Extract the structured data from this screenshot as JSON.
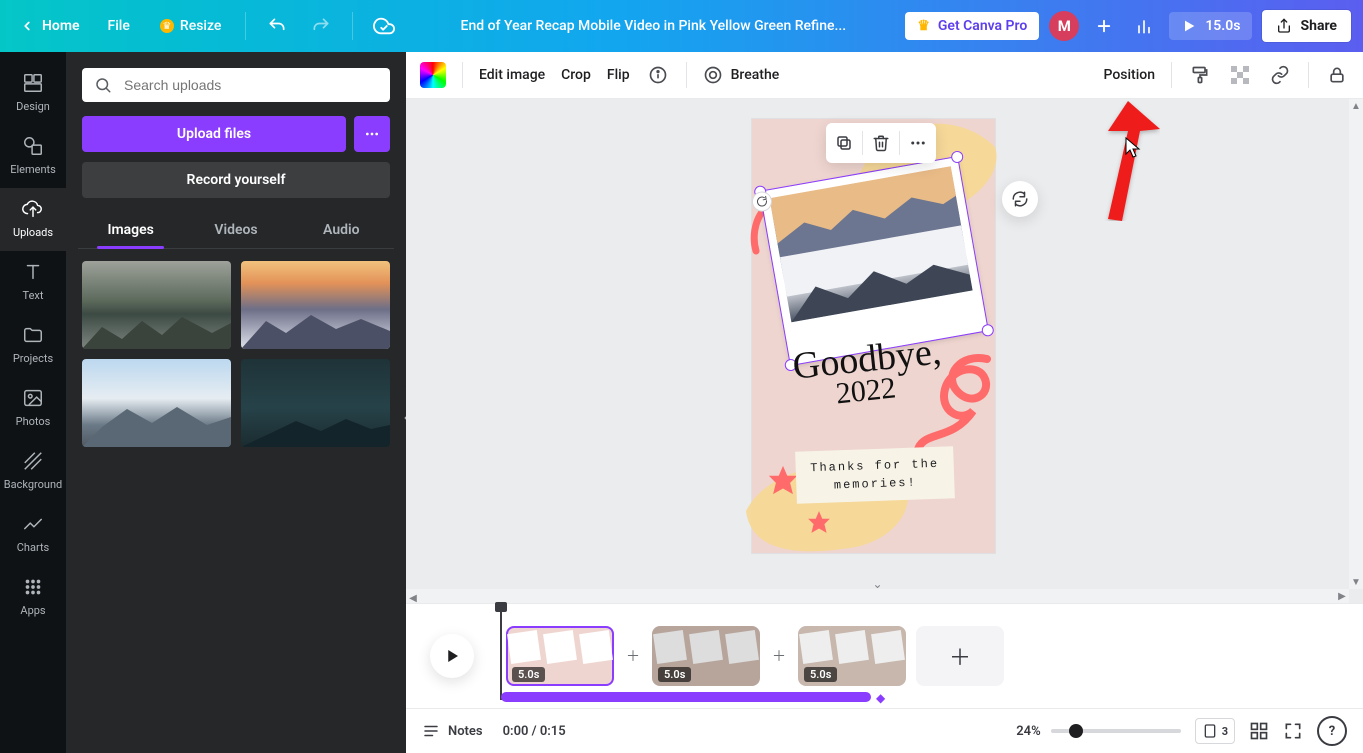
{
  "topbar": {
    "home": "Home",
    "file": "File",
    "resize": "Resize",
    "title": "End of Year Recap Mobile Video in Pink Yellow Green Refine...",
    "pro": "Get Canva Pro",
    "avatar": "M",
    "duration": "15.0s",
    "share": "Share"
  },
  "rail": {
    "design": "Design",
    "elements": "Elements",
    "uploads": "Uploads",
    "text": "Text",
    "projects": "Projects",
    "photos": "Photos",
    "background": "Background",
    "charts": "Charts",
    "apps": "Apps"
  },
  "panel": {
    "search_placeholder": "Search uploads",
    "upload": "Upload files",
    "record": "Record yourself",
    "tabs": {
      "images": "Images",
      "videos": "Videos",
      "audio": "Audio"
    }
  },
  "toolbar": {
    "edit_image": "Edit image",
    "crop": "Crop",
    "flip": "Flip",
    "breathe": "Breathe",
    "position": "Position"
  },
  "page_content": {
    "goodbye_line1": "Goodbye,",
    "goodbye_line2": "2022",
    "memo_line1": "Thanks for the",
    "memo_line2": "memories!"
  },
  "timeline": {
    "clip1": "5.0s",
    "clip2": "5.0s",
    "clip3": "5.0s"
  },
  "status": {
    "notes": "Notes",
    "time": "0:00 / 0:15",
    "zoom": "24%",
    "pages": "3"
  }
}
